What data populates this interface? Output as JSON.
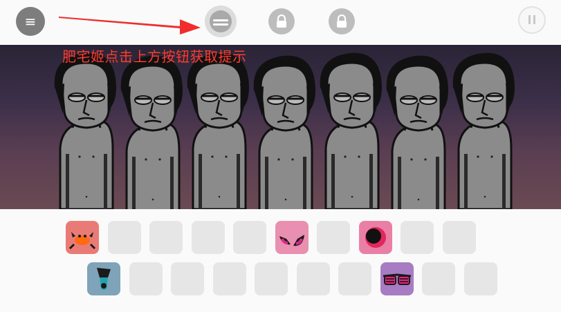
{
  "toolbar": {
    "menu_icon": "≡",
    "hint_icon": "hint-disc-icon",
    "lock_icons": [
      "lock-icon",
      "lock-icon"
    ],
    "pause_icon": "pause-icon"
  },
  "stage": {
    "hint_text": "肥宅姬点击上方按钮获取提示",
    "character_count": 7,
    "accent_color": "#ff3b30"
  },
  "tray": {
    "row1": [
      {
        "type": "crab",
        "color": "#e97b76"
      },
      {
        "type": "empty"
      },
      {
        "type": "empty"
      },
      {
        "type": "empty"
      },
      {
        "type": "empty"
      },
      {
        "type": "horns",
        "color": "#e98fb0"
      },
      {
        "type": "empty"
      },
      {
        "type": "dot",
        "color": "#ea7fa6"
      },
      {
        "type": "empty"
      },
      {
        "type": "empty"
      }
    ],
    "row2": [
      {
        "type": "cup",
        "color": "#7fa3b8"
      },
      {
        "type": "empty"
      },
      {
        "type": "empty"
      },
      {
        "type": "empty"
      },
      {
        "type": "empty"
      },
      {
        "type": "empty"
      },
      {
        "type": "empty"
      },
      {
        "type": "glasses",
        "color": "#a77cc3"
      },
      {
        "type": "empty"
      },
      {
        "type": "empty"
      }
    ]
  }
}
